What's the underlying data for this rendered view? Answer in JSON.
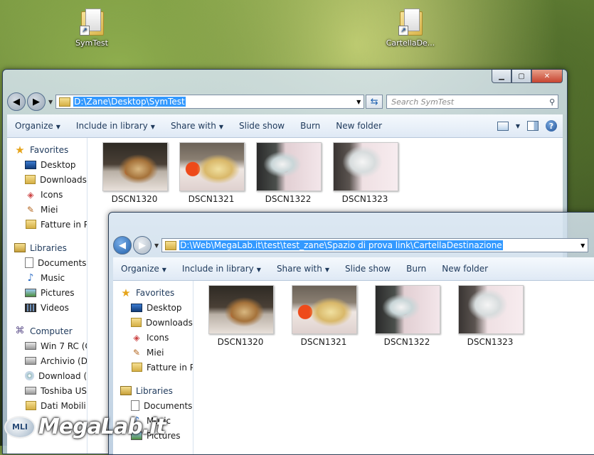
{
  "desktop": {
    "icons": [
      {
        "label": "SymTest"
      },
      {
        "label": "CartellaDe..."
      }
    ]
  },
  "window1": {
    "address": "D:\\Zane\\Desktop\\SymTest",
    "search_placeholder": "Search SymTest",
    "toolbar": {
      "organize": "Organize",
      "include": "Include in library",
      "share": "Share with",
      "slideshow": "Slide show",
      "burn": "Burn",
      "newfolder": "New folder"
    },
    "nav": [
      {
        "label": "Favorites",
        "icon": "star"
      },
      {
        "label": "Desktop",
        "icon": "desktop"
      },
      {
        "label": "Downloads",
        "icon": "downloads"
      },
      {
        "label": "Icons",
        "icon": "icons"
      },
      {
        "label": "Miei",
        "icon": "miei"
      },
      {
        "label": "Fatture in P",
        "icon": "folder"
      },
      {
        "label": "Libraries",
        "icon": "libraries"
      },
      {
        "label": "Documents",
        "icon": "document"
      },
      {
        "label": "Music",
        "icon": "music"
      },
      {
        "label": "Pictures",
        "icon": "pictures"
      },
      {
        "label": "Videos",
        "icon": "videos"
      },
      {
        "label": "Computer",
        "icon": "computer"
      },
      {
        "label": "Win 7 RC (C",
        "icon": "drive"
      },
      {
        "label": "Archivio (D:",
        "icon": "drive"
      },
      {
        "label": "Download (",
        "icon": "cd"
      },
      {
        "label": "Toshiba US",
        "icon": "drive"
      },
      {
        "label": "Dati Mobili",
        "icon": "folder"
      }
    ],
    "files": [
      "DSCN1320",
      "DSCN1321",
      "DSCN1322",
      "DSCN1323"
    ]
  },
  "window2": {
    "address": "D:\\Web\\MegaLab.it\\test\\test_zane\\Spazio di prova link\\CartellaDestinazione",
    "toolbar": {
      "organize": "Organize",
      "include": "Include in library",
      "share": "Share with",
      "slideshow": "Slide show",
      "burn": "Burn",
      "newfolder": "New folder"
    },
    "nav": [
      {
        "label": "Favorites",
        "icon": "star"
      },
      {
        "label": "Desktop",
        "icon": "desktop"
      },
      {
        "label": "Downloads",
        "icon": "downloads"
      },
      {
        "label": "Icons",
        "icon": "icons"
      },
      {
        "label": "Miei",
        "icon": "miei"
      },
      {
        "label": "Fatture in P",
        "icon": "folder"
      },
      {
        "label": "Libraries",
        "icon": "libraries"
      },
      {
        "label": "Documents",
        "icon": "document"
      },
      {
        "label": "Music",
        "icon": "music"
      },
      {
        "label": "Pictures",
        "icon": "pictures"
      }
    ],
    "files": [
      "DSCN1320",
      "DSCN1321",
      "DSCN1322",
      "DSCN1323"
    ]
  },
  "watermark": {
    "badge": "MLI",
    "text": "MegaLab.it"
  }
}
